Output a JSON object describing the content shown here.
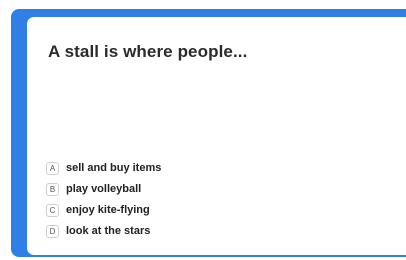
{
  "quiz": {
    "question": "A stall is where people...",
    "options": [
      {
        "letter": "A",
        "text": "sell and buy items"
      },
      {
        "letter": "B",
        "text": "play volleyball"
      },
      {
        "letter": "C",
        "text": "enjoy kite-flying"
      },
      {
        "letter": "D",
        "text": "look at the stars"
      }
    ]
  },
  "colors": {
    "frame": "#2f7fe6",
    "card": "#ffffff",
    "question_text": "#2b2b2b"
  }
}
